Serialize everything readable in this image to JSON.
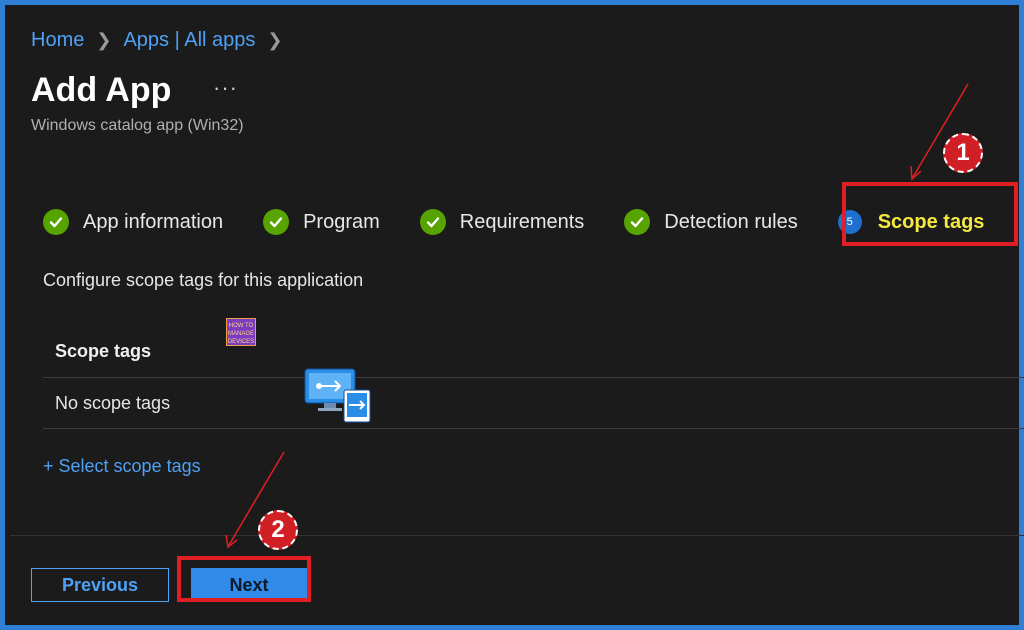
{
  "breadcrumb": {
    "home": "Home",
    "apps": "Apps | All apps"
  },
  "header": {
    "title": "Add App",
    "more": "···",
    "subtitle": "Windows catalog app (Win32)"
  },
  "steps": [
    {
      "label": "App information",
      "status": "done"
    },
    {
      "label": "Program",
      "status": "done"
    },
    {
      "label": "Requirements",
      "status": "done"
    },
    {
      "label": "Detection rules",
      "status": "done"
    },
    {
      "label": "Scope tags",
      "status": "active",
      "number": "5"
    }
  ],
  "main": {
    "description": "Configure scope tags for this application",
    "table": {
      "header": "Scope tags",
      "rows": [
        "No scope tags"
      ]
    },
    "select_link": "+ Select scope tags"
  },
  "footer": {
    "previous": "Previous",
    "next": "Next"
  },
  "annotations": {
    "callout1": "1",
    "callout2": "2"
  },
  "watermark": {
    "text": "HOW TO MANAGE DEVICES"
  },
  "colors": {
    "accent": "#2f7fd6",
    "highlight": "#e01e25",
    "check": "#57a300",
    "active_label": "#f4e842",
    "link": "#4ea1f5"
  }
}
